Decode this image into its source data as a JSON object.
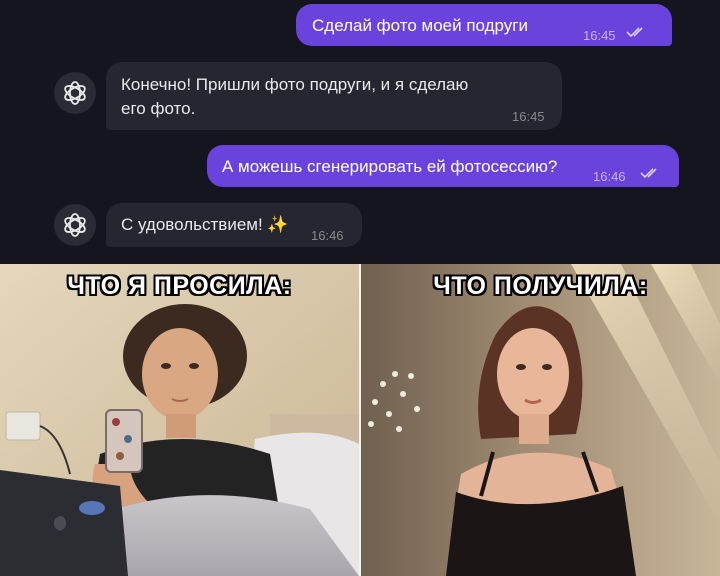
{
  "messages": [
    {
      "text": "Сделай фото моей подруги",
      "time": "16:45"
    },
    {
      "text_line1": "Конечно! Пришли фото подруги, и я сделаю",
      "text_line2": "его фото.",
      "time": "16:45"
    },
    {
      "text": "А можешь сгенерировать ей фотосессию?",
      "time": "16:46"
    },
    {
      "text": "С удовольствием! ✨",
      "time": "16:46"
    }
  ],
  "meme": {
    "left_caption": "ЧТО Я ПРОСИЛА:",
    "right_caption": "ЧТО ПОЛУЧИЛА:"
  },
  "icons": {
    "avatar": "openai-logo-icon",
    "read_receipt": "double-check-icon",
    "laptop_logo": "apple-logo-icon"
  },
  "colors": {
    "background": "#14151e",
    "outgoing_bubble": "#6a43dc",
    "incoming_bubble": "#25262f"
  }
}
